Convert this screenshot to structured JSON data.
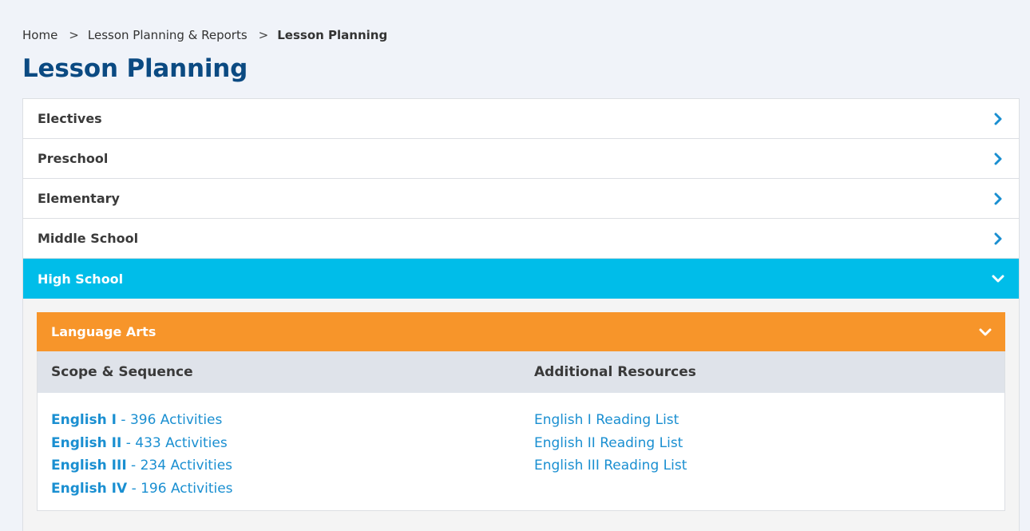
{
  "breadcrumb": {
    "home": "Home",
    "separator": ">",
    "parent": "Lesson Planning & Reports",
    "current": "Lesson Planning"
  },
  "page_title": "Lesson Planning",
  "accordion": {
    "items": [
      {
        "label": "Electives",
        "icon": "chevron-right-icon"
      },
      {
        "label": "Preschool",
        "icon": "chevron-right-icon"
      },
      {
        "label": "Elementary",
        "icon": "chevron-right-icon"
      },
      {
        "label": "Middle School",
        "icon": "chevron-right-icon"
      },
      {
        "label": "High School",
        "icon": "chevron-down-icon",
        "expanded": true
      }
    ],
    "active_color": "#00bde9"
  },
  "subsection": {
    "label": "Language Arts",
    "icon": "chevron-down-icon",
    "color": "#f7952a",
    "columns": {
      "scope": "Scope & Sequence",
      "resources": "Additional Resources"
    },
    "scope_items": [
      {
        "name": "English I",
        "count": " - 396 Activities"
      },
      {
        "name": "English II",
        "count": " - 433 Activities"
      },
      {
        "name": "English III",
        "count": " - 234 Activities"
      },
      {
        "name": "English IV",
        "count": " - 196 Activities"
      }
    ],
    "resource_items": [
      {
        "label": "English I Reading List"
      },
      {
        "label": "English II Reading List"
      },
      {
        "label": "English III Reading List"
      }
    ]
  },
  "colors": {
    "title": "#0b4a82",
    "link": "#1a8fd1"
  }
}
